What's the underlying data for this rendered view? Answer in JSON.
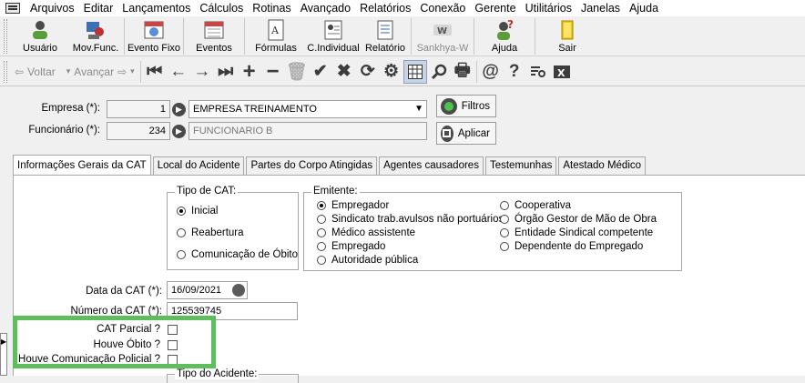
{
  "menubar": {
    "items": [
      "Arquivos",
      "Editar",
      "Lançamentos",
      "Cálculos",
      "Rotinas",
      "Avançado",
      "Relatórios",
      "Conexão",
      "Gerente",
      "Utilitários",
      "Janelas",
      "Ajuda"
    ]
  },
  "toolbar": {
    "buttons": [
      {
        "label": "Usuário",
        "icon": "user-icon"
      },
      {
        "label": "Mov.Func.",
        "icon": "mov-func-icon"
      },
      {
        "label": "Evento Fixo",
        "icon": "calendar-globe-icon"
      },
      {
        "label": "Eventos",
        "icon": "calendar-icon"
      },
      {
        "label": "Fórmulas",
        "icon": "formula-icon"
      },
      {
        "label": "C.Individual",
        "icon": "individual-card-icon"
      },
      {
        "label": "Relatório",
        "icon": "report-icon"
      },
      {
        "label": "Sankhya-W",
        "icon": "sankhya-logo-icon",
        "disabled": true
      },
      {
        "label": "Ajuda",
        "icon": "help-person-icon"
      },
      {
        "label": "Sair",
        "icon": "exit-door-icon"
      }
    ]
  },
  "nav": {
    "back_label": "Voltar",
    "forward_label": "Avançar"
  },
  "header": {
    "empresa_label": "Empresa (*):",
    "empresa_code": "1",
    "empresa_name": "EMPRESA TREINAMENTO",
    "funcionario_label": "Funcionário (*):",
    "funcionario_code": "234",
    "funcionario_name": "FUNCIONARIO B",
    "filtros_label": "Filtros",
    "aplicar_label": "Aplicar"
  },
  "tabs": [
    "Informações Gerais da CAT",
    "Local do Acidente",
    "Partes do Corpo Atingidas",
    "Agentes causadores",
    "Testemunhas",
    "Atestado Médico"
  ],
  "form": {
    "tipo_cat_title": "Tipo de CAT:",
    "tipo_cat_options": [
      "Inicial",
      "Reabertura",
      "Comunicação de Óbito"
    ],
    "emitente_title": "Emitente:",
    "emitente_col1": [
      "Empregador",
      "Sindicato trab.avulsos não portuários",
      "Médico assistente",
      "Empregado",
      "Autoridade pública"
    ],
    "emitente_col2": [
      "Cooperativa",
      "Órgão Gestor de Mão de Obra",
      "Entidade Sindical competente",
      "Dependente do Empregado"
    ],
    "data_cat_label": "Data da CAT (*):",
    "data_cat_value": "16/09/2021",
    "numero_cat_label": "Número da CAT (*):",
    "numero_cat_value": "125539745",
    "cat_parcial_label": "CAT Parcial ?",
    "houve_obito_label": "Houve Óbito ?",
    "houve_policial_label": "Houve Comunicação Policial ?",
    "tipo_acidente_title": "Tipo do Acidente:"
  },
  "colors": {
    "highlight": "#5cbf5c",
    "menubar": "#ffffff",
    "window": "#f0f0f0"
  }
}
